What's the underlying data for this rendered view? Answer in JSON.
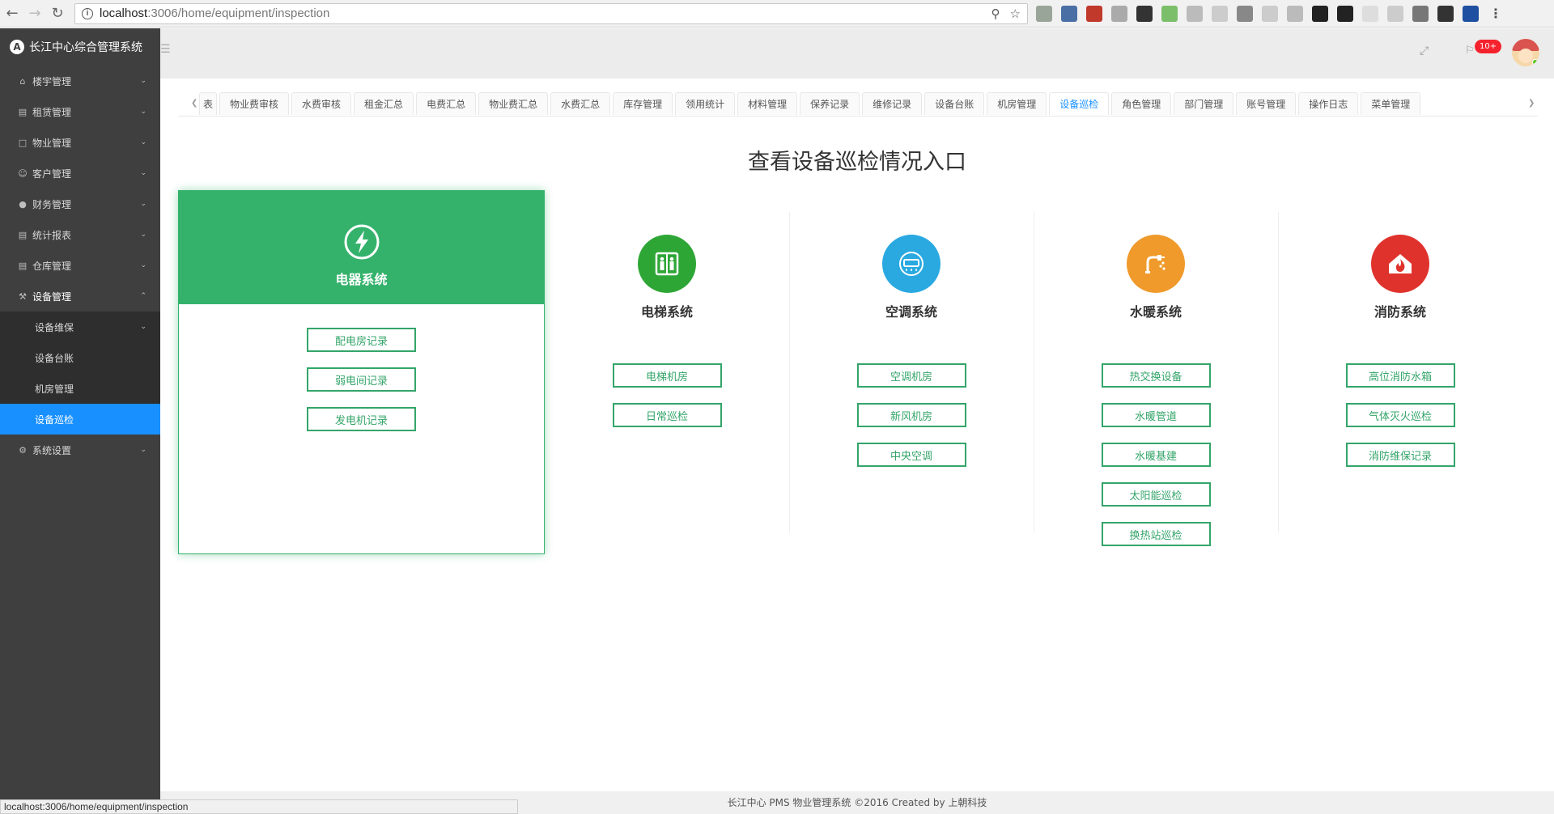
{
  "browser": {
    "url_host": "localhost",
    "url_path": ":3006/home/equipment/inspection",
    "status_url": "localhost:3006/home/equipment/inspection"
  },
  "app": {
    "logo_letter": "A",
    "title": "长江中心综合管理系统"
  },
  "sidebar": {
    "items": [
      {
        "label": "楼宇管理",
        "icon": "home-icon"
      },
      {
        "label": "租赁管理",
        "icon": "card-icon"
      },
      {
        "label": "物业管理",
        "icon": "folder-icon"
      },
      {
        "label": "客户管理",
        "icon": "user-icon"
      },
      {
        "label": "财务管理",
        "icon": "coin-icon"
      },
      {
        "label": "统计报表",
        "icon": "report-icon"
      },
      {
        "label": "仓库管理",
        "icon": "warehouse-icon"
      },
      {
        "label": "设备管理",
        "icon": "wrench-icon"
      },
      {
        "label": "系统设置",
        "icon": "gear-icon"
      }
    ],
    "sub_items": [
      "设备维保",
      "设备台账",
      "机房管理",
      "设备巡检"
    ]
  },
  "header": {
    "badge": "10+"
  },
  "tabs": [
    "表",
    "物业费审核",
    "水费审核",
    "租金汇总",
    "电费汇总",
    "物业费汇总",
    "水费汇总",
    "库存管理",
    "领用统计",
    "材料管理",
    "保养记录",
    "维修记录",
    "设备台账",
    "机房管理",
    "设备巡检",
    "角色管理",
    "部门管理",
    "账号管理",
    "操作日志",
    "菜单管理"
  ],
  "active_tab_index": 14,
  "page_title": "查看设备巡检情况入口",
  "systems": [
    {
      "title": "电器系统",
      "icon": "lightning-icon",
      "color": "#34b26b",
      "buttons": [
        "配电房记录",
        "弱电间记录",
        "发电机记录"
      ]
    },
    {
      "title": "电梯系统",
      "icon": "elevator-icon",
      "color": "#2ea636",
      "buttons": [
        "电梯机房",
        "日常巡检"
      ]
    },
    {
      "title": "空调系统",
      "icon": "air-conditioner-icon",
      "color": "#29a9e0",
      "buttons": [
        "空调机房",
        "新风机房",
        "中央空调"
      ]
    },
    {
      "title": "水暖系统",
      "icon": "water-heating-icon",
      "color": "#ef9a2b",
      "buttons": [
        "热交换设备",
        "水暖管道",
        "水暖基建",
        "太阳能巡检",
        "换热站巡检"
      ]
    },
    {
      "title": "消防系统",
      "icon": "fire-icon",
      "color": "#e0322c",
      "buttons": [
        "高位消防水箱",
        "气体灭火巡检",
        "消防维保记录"
      ]
    }
  ],
  "footer": "长江中心 PMS 物业管理系统 ©2016 Created by 上朝科技"
}
